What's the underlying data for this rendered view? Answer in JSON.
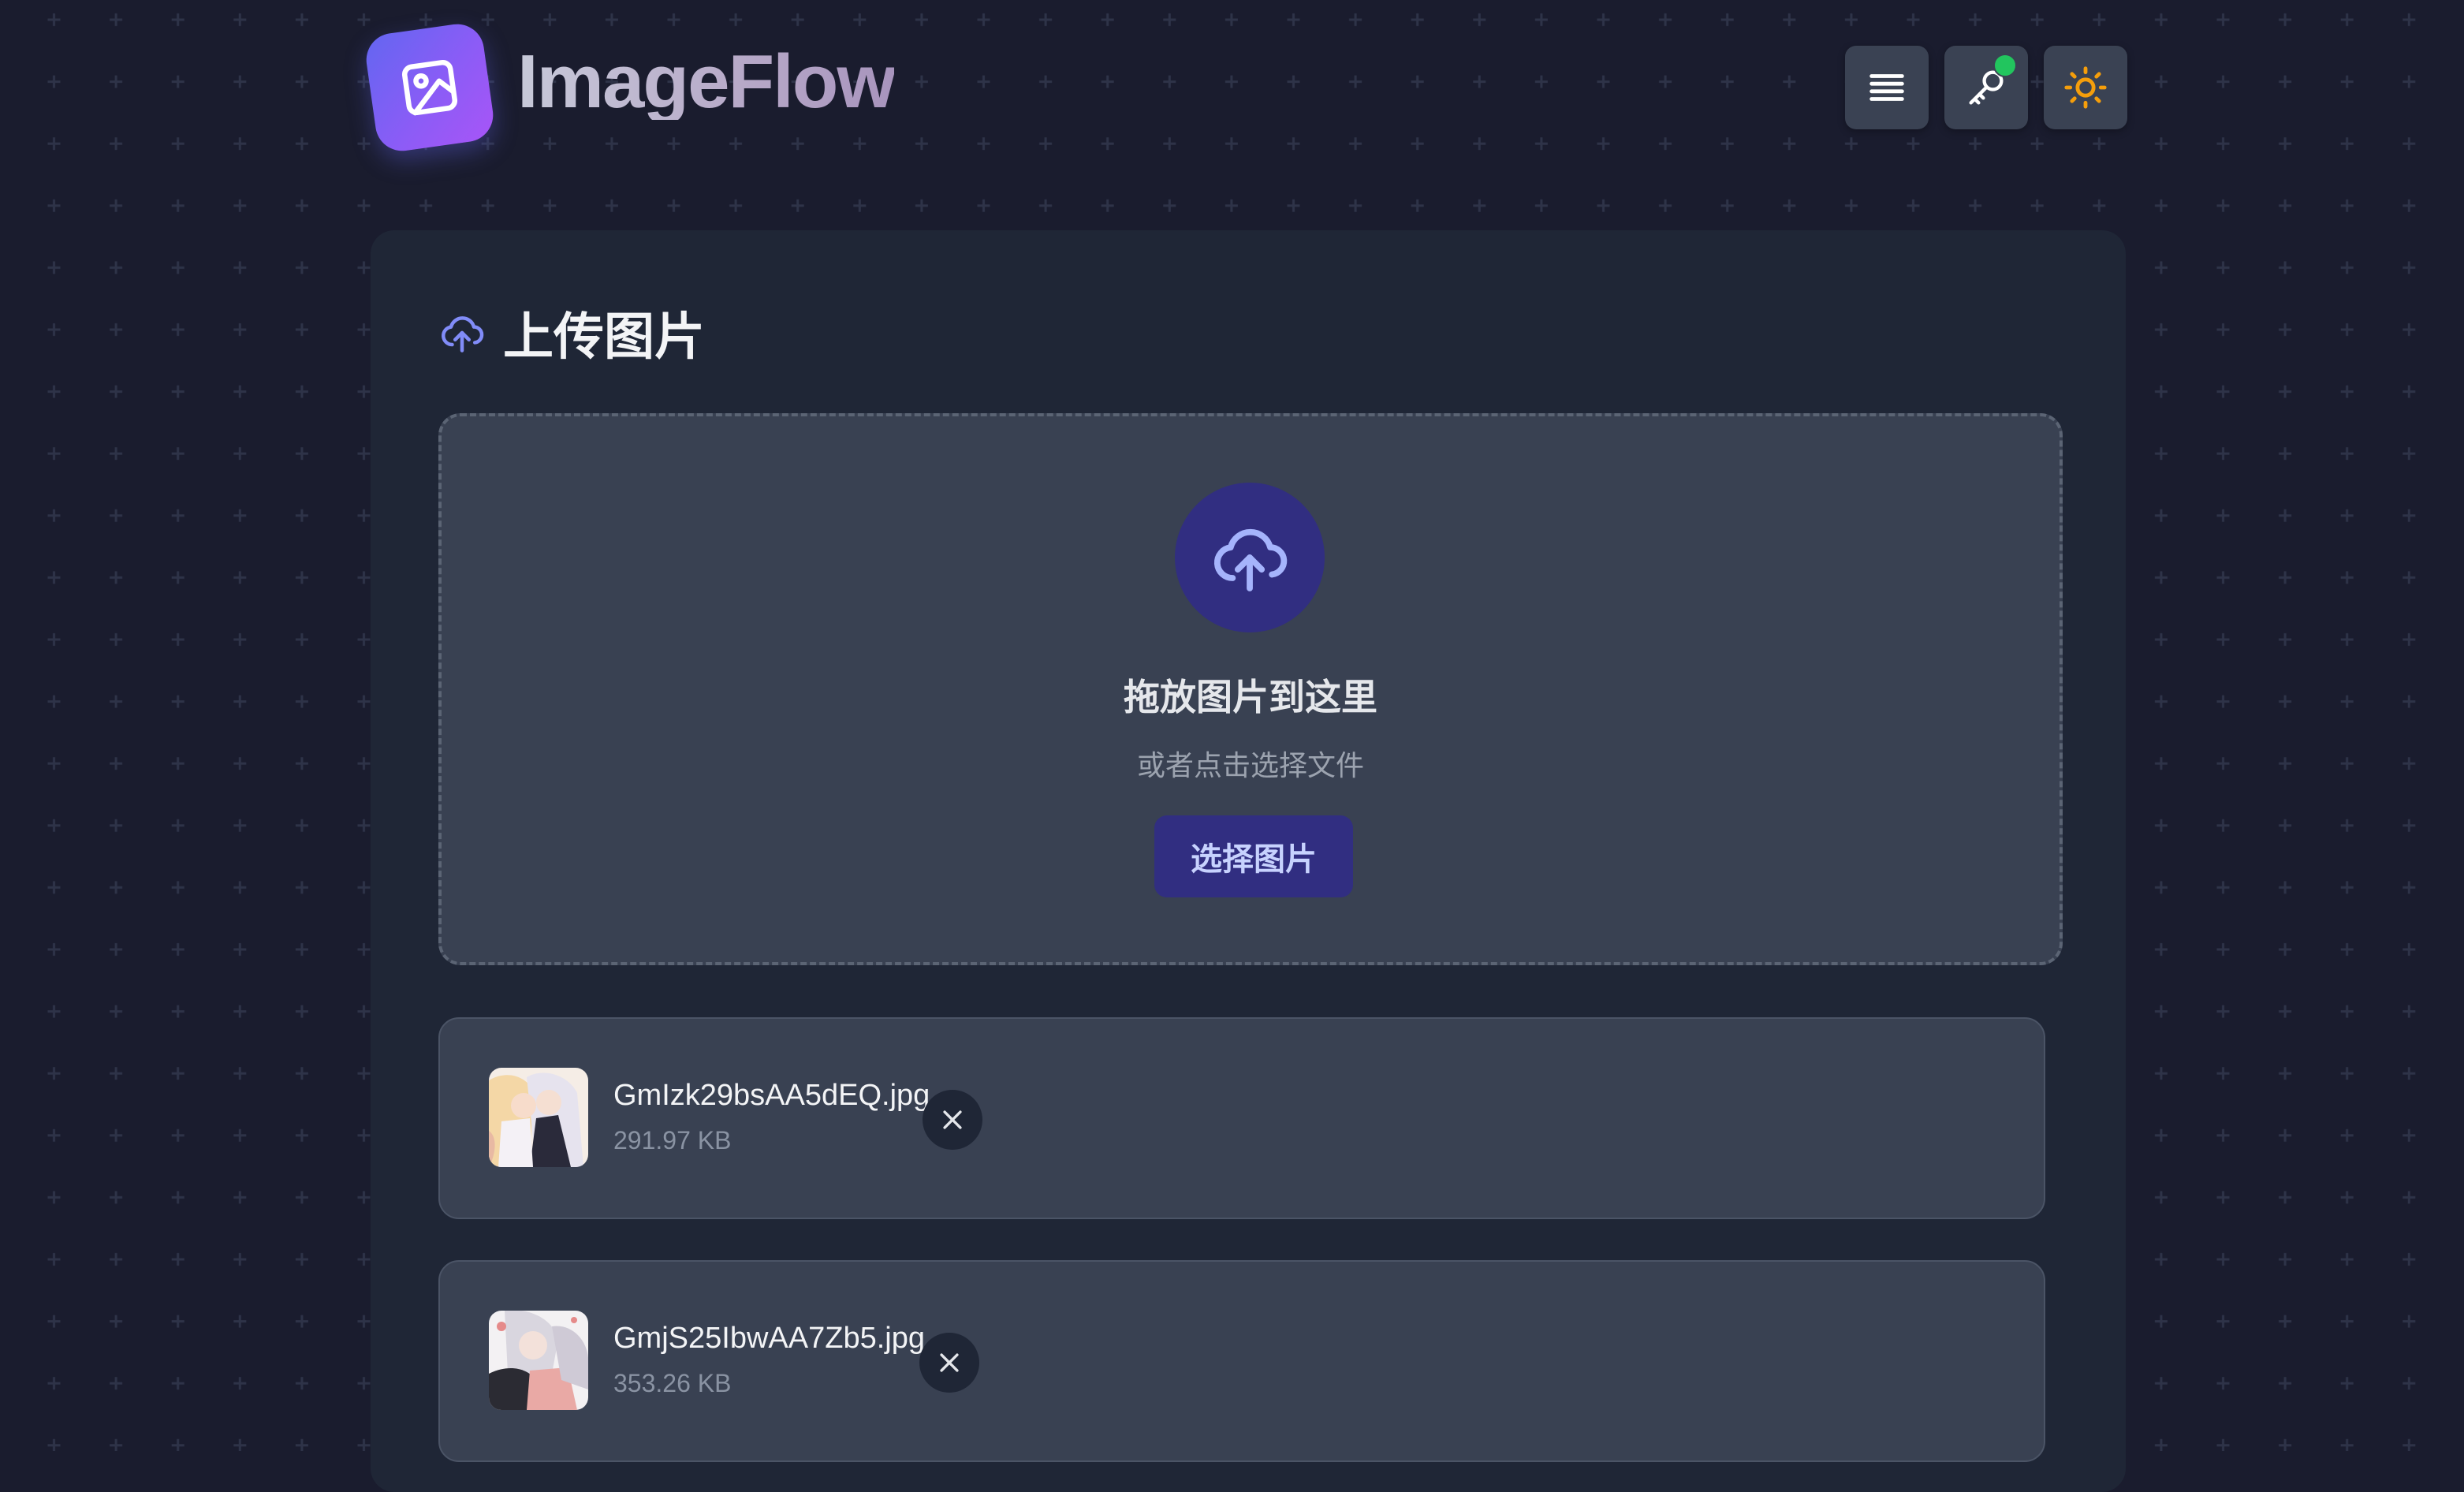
{
  "app": {
    "title": "ImageFlow"
  },
  "header": {
    "buttons": [
      {
        "name": "menu",
        "icon": "menu-icon"
      },
      {
        "name": "api-key",
        "icon": "key-icon",
        "status_color": "#22c55e"
      },
      {
        "name": "theme",
        "icon": "sun-icon"
      }
    ]
  },
  "upload": {
    "title": "上传图片",
    "icon": "upload-cloud-icon",
    "dropzone": {
      "title": "拖放图片到这里",
      "subtitle": "或者点击选择文件",
      "button_label": "选择图片"
    }
  },
  "files": [
    {
      "name": "GmIzk29bsAA5dEQ.jpg",
      "size": "291.97 KB"
    },
    {
      "name": "GmjS25IbwAA7Zb5.jpg",
      "size": "353.26 KB"
    }
  ],
  "colors": {
    "background": "#1a1c2e",
    "card": "#1f2636",
    "panel": "#394152",
    "accent": "#6366f1",
    "accent_dark": "#312e81",
    "status_online": "#22c55e",
    "sun": "#f59e0b"
  }
}
